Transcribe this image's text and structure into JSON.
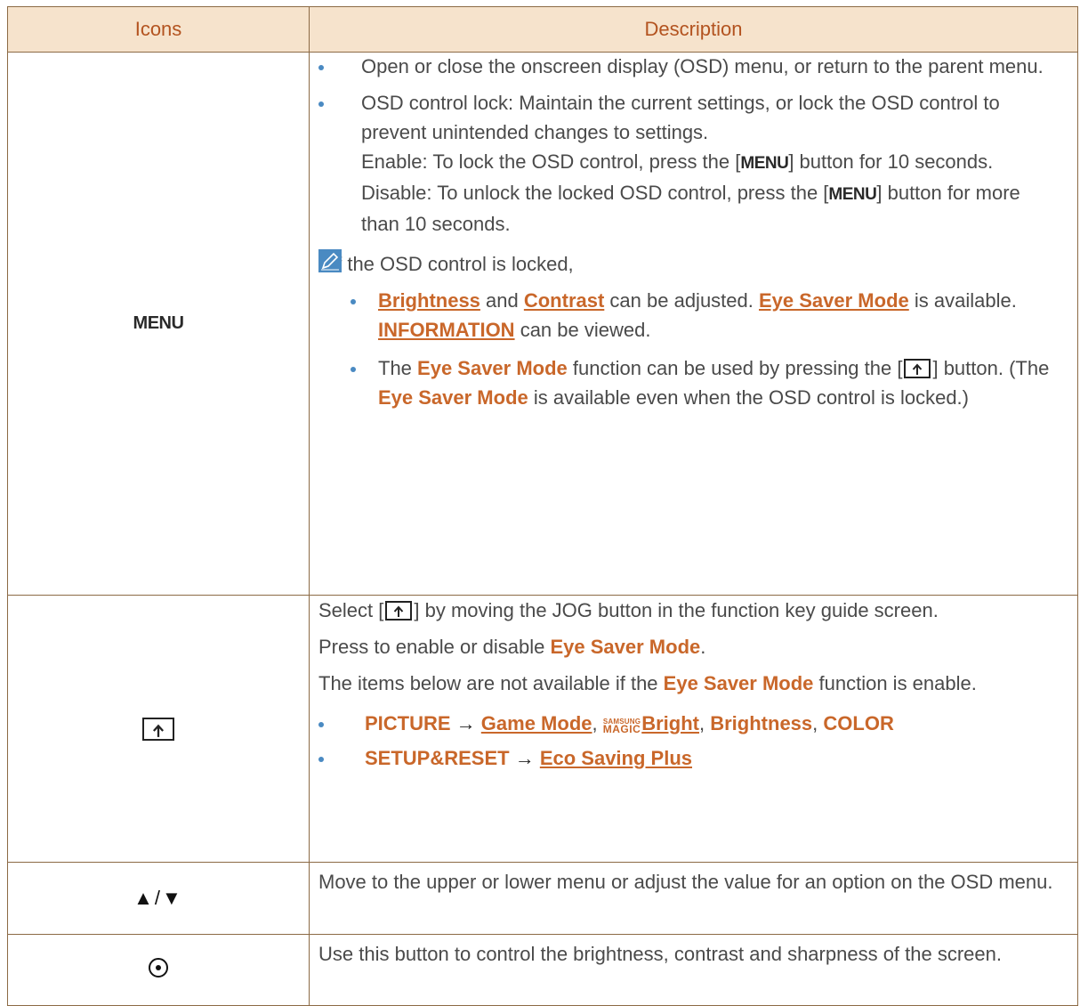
{
  "table": {
    "headers": {
      "icons": "Icons",
      "description": "Description"
    },
    "rows": [
      {
        "icon_label": "MENU",
        "bullet1": "Open or close the onscreen display (OSD) menu, or return to the parent menu.",
        "bullet2_main": "OSD control lock: Maintain the current settings, or lock the OSD control to prevent unintended changes to settings.",
        "enable_pre": "Enable: To lock the OSD control, press the [",
        "enable_key": "MENU",
        "enable_post": "] button for 10 seconds.",
        "disable_pre": "Disable: To unlock the locked OSD control, press the [",
        "disable_key": "MENU",
        "disable_post": "] button for more than 10 seconds.",
        "note_intro": "If the OSD control is locked,",
        "note1": {
          "brightness": "Brightness",
          "and": " and ",
          "contrast": "Contrast",
          "can_adjust": " can be adjusted. ",
          "eye_saver": "Eye Saver Mode",
          "is_available": " is available. ",
          "information": "INFORMATION",
          "can_view": " can be viewed."
        },
        "note2": {
          "pre": "The ",
          "eye_saver": "Eye Saver Mode",
          "mid": " function can be used by pressing the [",
          "post1": "] button. (The ",
          "eye_saver2": "Eye Saver Mode",
          "post2": " is available even when the OSD control is locked.)"
        }
      },
      {
        "icon_name": "eye-saver-key-icon",
        "p1_pre": "Select [",
        "p1_post": "] by moving the JOG button in the function key guide screen.",
        "p2_pre": "Press to enable or disable ",
        "p2_hl": "Eye Saver Mode",
        "p2_post": ".",
        "p3_pre": "The items below are not available if the ",
        "p3_hl": "Eye Saver Mode",
        "p3_post": " function is enable.",
        "list1": {
          "picture": "PICTURE",
          "arrow": " → ",
          "game_mode": "Game Mode",
          "comma1": ", ",
          "samsung": "SAMSUNG",
          "magic": "MAGIC",
          "bright": "Bright",
          "comma2": ", ",
          "brightness": "Brightness",
          "comma3": ", ",
          "color": "COLOR"
        },
        "list2": {
          "setup": "SETUP&RESET",
          "arrow": " → ",
          "eco": "Eco Saving Plus"
        }
      },
      {
        "icon_label": "▲/▼",
        "text": "Move to the upper or lower menu or adjust the value for an option on the OSD menu."
      },
      {
        "icon_name": "jog-button-icon",
        "text": "Use this button to control the brightness, contrast and sharpness of the screen."
      }
    ]
  }
}
